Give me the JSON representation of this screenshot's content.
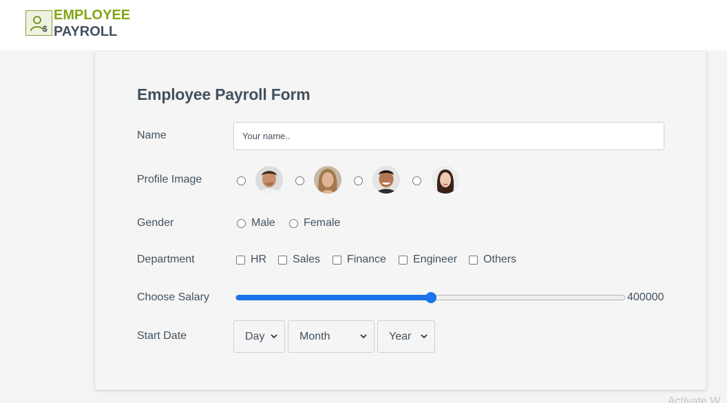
{
  "header": {
    "logo_line1": "EMPLOYEE",
    "logo_line2": "PAYROLL",
    "logo_icon": "employee-payroll-icon"
  },
  "form": {
    "title": "Employee Payroll Form",
    "name": {
      "label": "Name",
      "placeholder": "Your name.."
    },
    "profile": {
      "label": "Profile Image",
      "options": [
        {
          "avatar": "male-avatar-1"
        },
        {
          "avatar": "female-avatar-1"
        },
        {
          "avatar": "male-avatar-2"
        },
        {
          "avatar": "female-avatar-2"
        }
      ]
    },
    "gender": {
      "label": "Gender",
      "options": [
        "Male",
        "Female"
      ]
    },
    "department": {
      "label": "Department",
      "options": [
        "HR",
        "Sales",
        "Finance",
        "Engineer",
        "Others"
      ]
    },
    "salary": {
      "label": "Choose Salary",
      "value": "400000",
      "fill_fraction": 0.5
    },
    "start_date": {
      "label": "Start Date",
      "day": "Day",
      "month": "Month",
      "year": "Year"
    }
  },
  "watermark": "Activate W",
  "colors": {
    "accent": "#1a73e8",
    "brand_green": "#82a516",
    "text": "#42515f"
  }
}
